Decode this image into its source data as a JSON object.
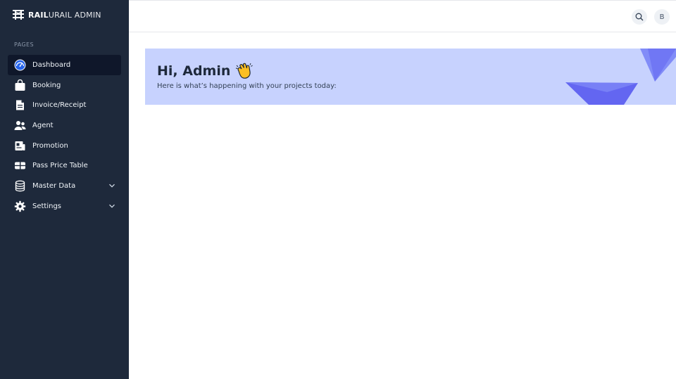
{
  "brand": {
    "title_bold": "RAIL",
    "title_rest": "URAIL ADMIN",
    "logo_icon": "railway-track-icon"
  },
  "sidebar": {
    "section_label": "PAGES",
    "items": [
      {
        "label": "Dashboard",
        "icon": "gauge-icon",
        "active": true
      },
      {
        "label": "Booking",
        "icon": "shopping-bag-icon"
      },
      {
        "label": "Invoice/Receipt",
        "icon": "document-icon"
      },
      {
        "label": "Agent",
        "icon": "users-icon"
      },
      {
        "label": "Promotion",
        "icon": "newspaper-icon"
      },
      {
        "label": "Pass Price Table",
        "icon": "ticket-icon"
      },
      {
        "label": "Master Data",
        "icon": "database-icon",
        "expandable": true
      },
      {
        "label": "Settings",
        "icon": "gear-icon",
        "expandable": true
      }
    ]
  },
  "topbar": {
    "avatar_initial": "B",
    "search_icon": "search-icon"
  },
  "banner": {
    "greeting": "Hi, Admin",
    "greeting_icon": "waving-hand-icon",
    "subtitle": "Here is what’s happening with your projects today:"
  },
  "colors": {
    "sidebar_bg": "#1e293b",
    "active_item_bg": "#0f172a",
    "banner_bg": "#c7d2fe",
    "accent": "#6366f1"
  }
}
